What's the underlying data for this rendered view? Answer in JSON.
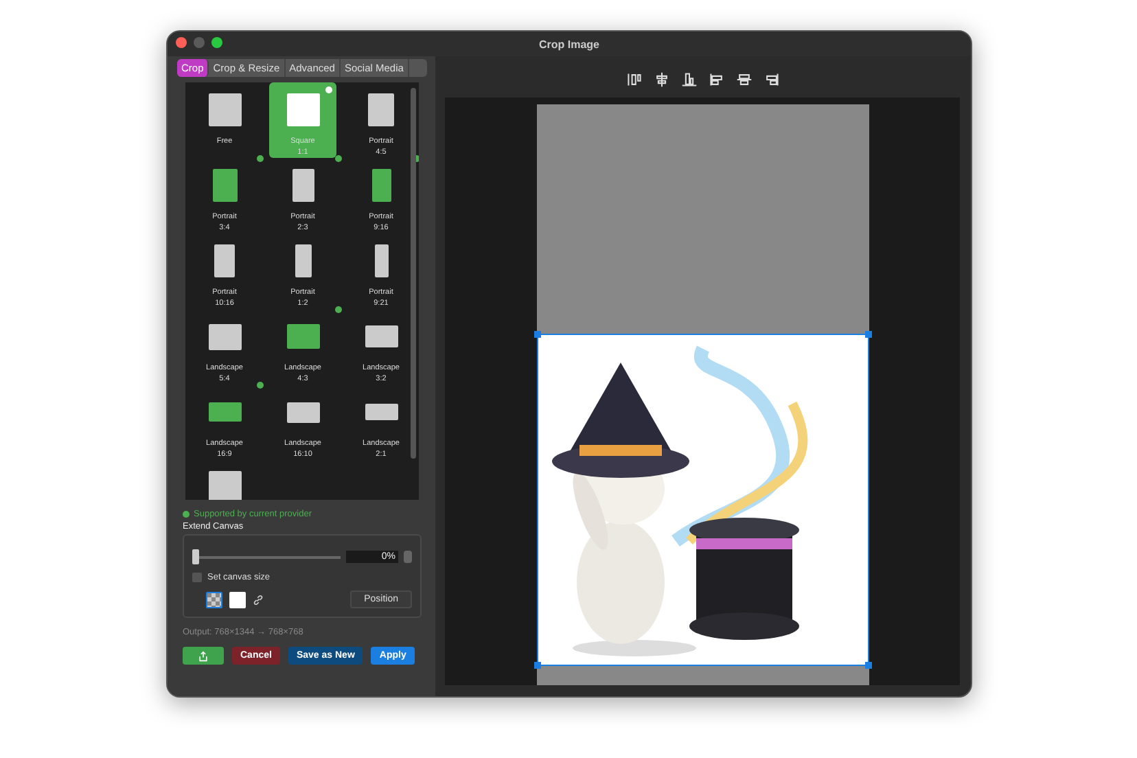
{
  "window": {
    "title": "Crop Image"
  },
  "tabs": [
    {
      "label": "Crop",
      "selected": true
    },
    {
      "label": "Crop & Resize",
      "selected": false
    },
    {
      "label": "Advanced",
      "selected": false
    },
    {
      "label": "Social Media",
      "selected": false
    }
  ],
  "presets": [
    {
      "name": "Free",
      "selected": false,
      "supported": true,
      "highlighted": false
    },
    {
      "name": "Square",
      "ratio": "1:1",
      "selected": true,
      "supported": true,
      "highlighted": false
    },
    {
      "name": "Portrait",
      "ratio": "4:5",
      "selected": false,
      "supported": true,
      "highlighted": false
    },
    {
      "name": "Portrait",
      "ratio": "3:4",
      "selected": false,
      "supported": false,
      "highlighted": true
    },
    {
      "name": "Portrait",
      "ratio": "2:3",
      "selected": false,
      "supported": false,
      "highlighted": false
    },
    {
      "name": "Portrait",
      "ratio": "9:16",
      "selected": false,
      "supported": false,
      "highlighted": true
    },
    {
      "name": "Portrait",
      "ratio": "10:16",
      "selected": false,
      "supported": false,
      "highlighted": false
    },
    {
      "name": "Portrait",
      "ratio": "1:2",
      "selected": false,
      "supported": true,
      "highlighted": false
    },
    {
      "name": "Portrait",
      "ratio": "9:21",
      "selected": false,
      "supported": false,
      "highlighted": false
    },
    {
      "name": "Landscape",
      "ratio": "5:4",
      "selected": false,
      "supported": true,
      "highlighted": false
    },
    {
      "name": "Landscape",
      "ratio": "4:3",
      "selected": false,
      "supported": false,
      "highlighted": true
    },
    {
      "name": "Landscape",
      "ratio": "3:2",
      "selected": false,
      "supported": false,
      "highlighted": false
    },
    {
      "name": "Landscape",
      "ratio": "16:9",
      "selected": false,
      "supported": false,
      "highlighted": true
    },
    {
      "name": "Landscape",
      "ratio": "16:10",
      "selected": false,
      "supported": false,
      "highlighted": false
    },
    {
      "name": "Landscape",
      "ratio": "2:1",
      "selected": false,
      "supported": false,
      "highlighted": false
    },
    {
      "selected": false,
      "supported": false,
      "highlighted": false
    }
  ],
  "legend": "Supported by current provider",
  "extend_canvas": {
    "title": "Extend Canvas",
    "slider": {
      "level": 0
    },
    "value": "0%",
    "set_canvas_size": {
      "label": "Set canvas size",
      "checked": false
    },
    "swatches": [
      {
        "kind": "transparent",
        "selected": true
      },
      {
        "kind": "white",
        "selected": false
      }
    ],
    "position_button": "Position"
  },
  "output": "Output: 768×1344 → 768×768",
  "buttons": [
    {
      "kind": "share",
      "color": "#3fa34d"
    },
    {
      "kind": "text",
      "label": "Cancel",
      "color": "#7d2228"
    },
    {
      "kind": "text",
      "label": "Save as New",
      "color": "#0d4a7d"
    },
    {
      "kind": "text",
      "label": "Apply",
      "color": "#1a7fe0"
    }
  ]
}
